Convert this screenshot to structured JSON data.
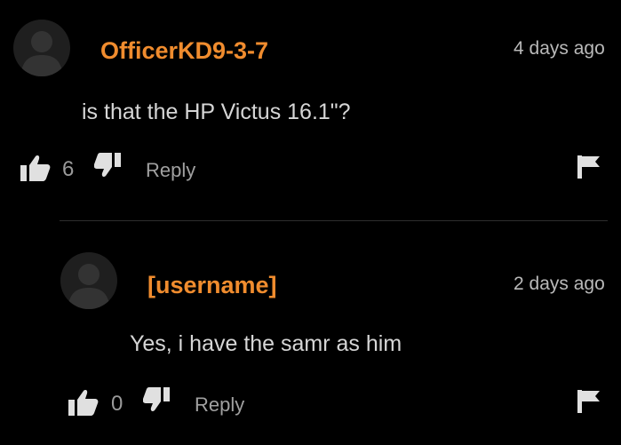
{
  "colors": {
    "background": "#000000",
    "username": "#f08c2e",
    "text": "#d6d6d6",
    "muted": "#a0a0a0",
    "icon": "#e0e0e0"
  },
  "comments": [
    {
      "username": "OfficerKD9-3-7",
      "time": "4 days ago",
      "text": "is that the HP Victus 16.1\"?",
      "likes": "6",
      "reply_label": "Reply",
      "icons": [
        "avatar-placeholder-icon",
        "thumbs-up-icon",
        "thumbs-down-icon",
        "flag-icon"
      ]
    },
    {
      "username": "[username]",
      "time": "2 days ago",
      "text": "Yes, i have the samr as him",
      "likes": "0",
      "reply_label": "Reply",
      "icons": [
        "avatar-placeholder-icon",
        "thumbs-up-icon",
        "thumbs-down-icon",
        "flag-icon"
      ]
    }
  ]
}
